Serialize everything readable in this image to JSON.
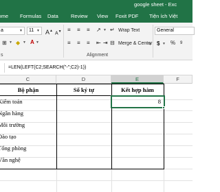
{
  "window": {
    "title": "google sheet - Exc"
  },
  "tabs": [
    "Home",
    "Formulas",
    "Data",
    "Review",
    "View",
    "Foxit PDF",
    "Tiện ích Việt"
  ],
  "ribbon": {
    "font_name": "a",
    "font_size": "11",
    "wrap_text": "Wrap Text",
    "merge_center": "Merge & Center",
    "number_format": "General",
    "currency_symbol": "$",
    "alignment_label": "Alignment",
    "font_group_label": "s"
  },
  "formula_bar": {
    "formula": "=LEN(LEFT(C2;SEARCH(\"-\";C2)-1))"
  },
  "columns": [
    "C",
    "D",
    "E",
    "F"
  ],
  "headers": {
    "c": "Bộ phận",
    "d": "Số ký tự",
    "e": "Kết hợp hàm"
  },
  "rows": [
    {
      "c": "Kiểm toán",
      "d": "",
      "e": "8"
    },
    {
      "c": "Ngân hàng",
      "d": "",
      "e": ""
    },
    {
      "c": "Môi trường",
      "d": "",
      "e": ""
    },
    {
      "c": "Đào tạo",
      "d": "",
      "e": ""
    },
    {
      "c": "Tổng phòng",
      "d": "",
      "e": ""
    },
    {
      "c": "Văn nghệ",
      "d": "",
      "e": ""
    }
  ],
  "colors": {
    "accent": "#217346"
  }
}
